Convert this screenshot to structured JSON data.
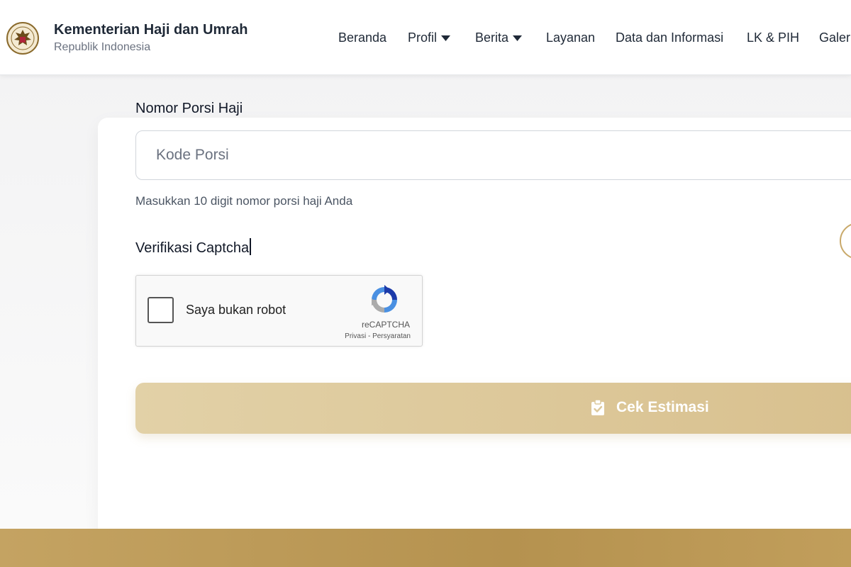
{
  "header": {
    "title": "Kementerian Haji dan Umrah",
    "subtitle": "Republik Indonesia",
    "logo_icon": "garuda-emblem-icon"
  },
  "nav": {
    "items": [
      {
        "label": "Beranda",
        "dropdown": false
      },
      {
        "label": "Profil",
        "dropdown": true
      },
      {
        "label": "Berita",
        "dropdown": true
      },
      {
        "label": "Layanan",
        "dropdown": false
      },
      {
        "label": "Data dan Informasi",
        "dropdown": false
      },
      {
        "label": "LK & PIH",
        "dropdown": false
      },
      {
        "label": "Galeri",
        "dropdown": false
      }
    ]
  },
  "form": {
    "porsi_label": "Nomor Porsi Haji",
    "porsi_placeholder": "Kode Porsi",
    "porsi_value": "",
    "porsi_hint": "Masukkan 10 digit nomor porsi haji Anda",
    "captcha_label": "Verifikasi Captcha",
    "submit_label": "Cek Estimasi",
    "submit_icon": "clipboard-check-icon"
  },
  "recaptcha": {
    "checkbox_label": "Saya bukan robot",
    "checked": false,
    "brand": "reCAPTCHA",
    "privacy": "Privasi",
    "separator": " - ",
    "terms": "Persyaratan"
  },
  "colors": {
    "accent_gold": "#c9a96a",
    "button_gold": "#dcc89b",
    "footer_gold": "#b8964f",
    "text_dark": "#1f2937",
    "text_muted": "#6b7280"
  }
}
